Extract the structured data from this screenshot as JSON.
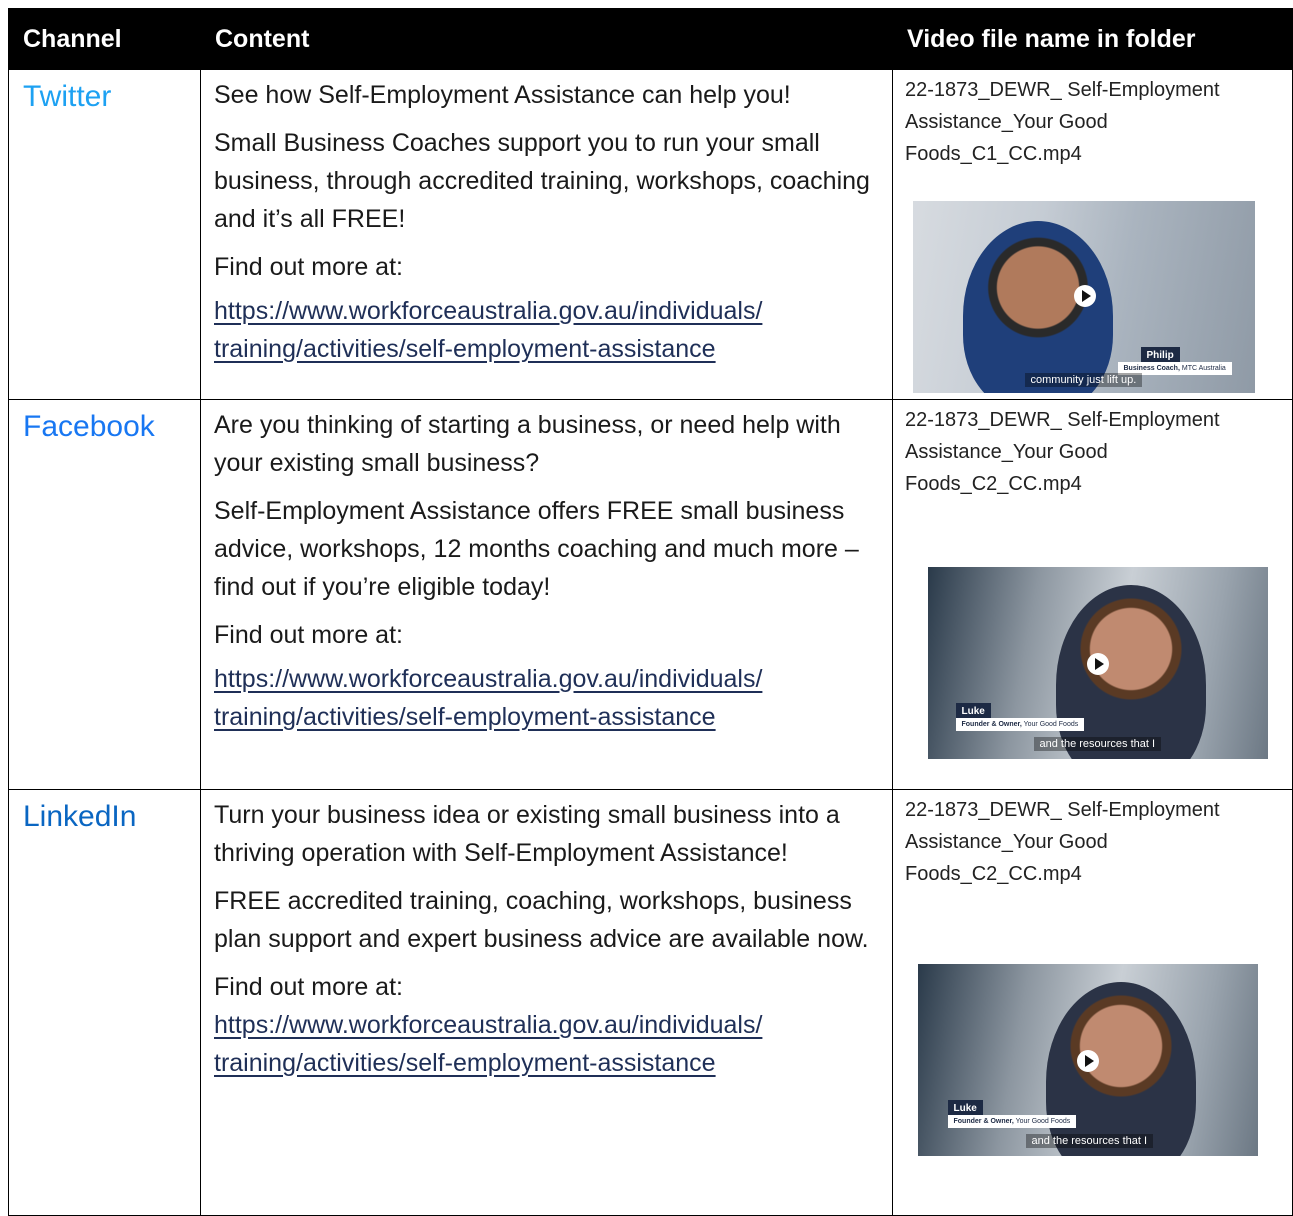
{
  "header": {
    "channel": "Channel",
    "content": "Content",
    "file": "Video file name in folder"
  },
  "rows": [
    {
      "channel": "Twitter",
      "channel_color": "#1da1f2",
      "paragraphs": [
        "See how Self-Employment Assistance can help you!",
        "Small Business Coaches support you to run your small business, through accredited training, workshops, coaching and it’s all FREE!",
        "Find out more at:"
      ],
      "link": "https://www.workforceaustralia.gov.au/individuals/training/activities/self-employment-assistance",
      "link_line1": "https://www.workforceaustralia.gov.au/individuals/",
      "link_line2": "training/activities/self-employment-assistance",
      "file_name": "22-1873_DEWR_ Self-Employment Assistance_Your Good Foods_C1_CC.mp4",
      "video": {
        "name_tag": "Philip",
        "role_bold": "Business Coach,",
        "role_rest": " MTC Australia",
        "caption": "community just lift up."
      }
    },
    {
      "channel": "Facebook",
      "channel_color": "#1877f2",
      "paragraphs": [
        "Are you thinking of starting a business, or need help with your existing small business?",
        "Self-Employment Assistance offers FREE small business advice, workshops, 12 months coaching and much more – find out if you’re eligible today!",
        "Find out more at:"
      ],
      "link": "https://www.workforceaustralia.gov.au/individuals/training/activities/self-employment-assistance",
      "link_line1": "https://www.workforceaustralia.gov.au/individuals/",
      "link_line2": "training/activities/self-employment-assistance",
      "file_name": "22-1873_DEWR_ Self-Employment Assistance_Your Good Foods_C2_CC.mp4",
      "video": {
        "name_tag": "Luke",
        "role_bold": "Founder & Owner,",
        "role_rest": " Your Good Foods",
        "caption": "and the resources that I"
      }
    },
    {
      "channel": "LinkedIn",
      "channel_color": "#0a66c2",
      "paragraphs": [
        "Turn your business idea or existing small business into a thriving operation with Self-Employment Assistance!",
        "FREE accredited training, coaching, workshops, business plan support and expert business advice are available now.",
        "Find out more at:"
      ],
      "link": "https://www.workforceaustralia.gov.au/individuals/training/activities/self-employment-assistance",
      "link_line1": "https://www.workforceaustralia.gov.au/individuals/",
      "link_line2": "training/activities/self-employment-assistance",
      "file_name": "22-1873_DEWR_ Self-Employment Assistance_Your Good Foods_C2_CC.mp4",
      "video": {
        "name_tag": "Luke",
        "role_bold": "Founder & Owner,",
        "role_rest": " Your Good Foods",
        "caption": "and the resources that I"
      }
    }
  ]
}
